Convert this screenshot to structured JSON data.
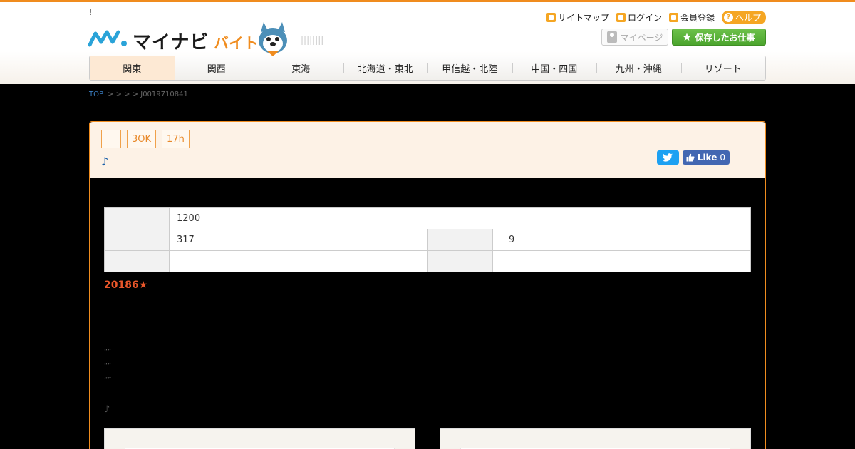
{
  "header": {
    "tiny_note": "!",
    "logo_text": "マイナビ",
    "logo_sub": "バイト",
    "logo_stripes": "||||||||",
    "util_links": [
      {
        "label": "サイトマップ",
        "icon": "sitemap-icon"
      },
      {
        "label": "ログイン",
        "icon": "lock-icon"
      },
      {
        "label": "会員登録",
        "icon": "user-add-icon"
      }
    ],
    "help_label": "ヘルプ",
    "help_icon_glyph": "?",
    "mypage_label": "マイページ",
    "saved_label": "保存したお仕事"
  },
  "regions": [
    "関東",
    "関西",
    "東海",
    "北海道・東北",
    "甲信越・北陸",
    "中国・四国",
    "九州・沖縄",
    "リゾート"
  ],
  "active_region": "関東",
  "breadcrumb": {
    "top": "TOP",
    "trail": "> > > > J0019710841"
  },
  "job": {
    "tags": [
      "",
      "3OK",
      "17h"
    ],
    "note_mark": "♪",
    "fb_like": "Like",
    "fb_count": "0",
    "table": {
      "row1_value": "1200",
      "row2_value_left": "317",
      "row2_value_right": "9"
    },
    "salary_line": "20186★",
    "quote_lines": [
      "“”",
      "“”",
      "“”"
    ],
    "note2": "♪"
  },
  "colors": {
    "brand_orange": "#f08c1e",
    "header_bg": "#ffffff",
    "card_head_bg": "#fdf2e6",
    "saved_green": "#4ca52e",
    "salary_red": "#e8562a",
    "link_blue": "#1a6fb8"
  }
}
